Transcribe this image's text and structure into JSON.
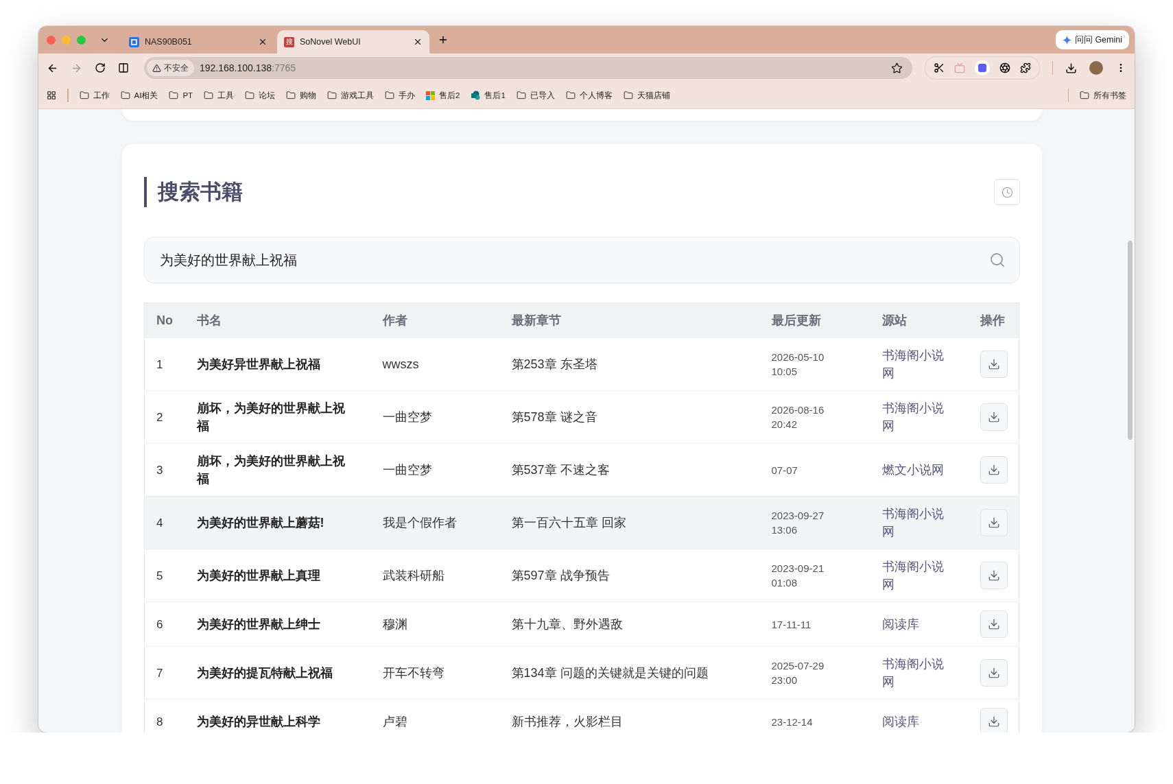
{
  "browser": {
    "tabs": [
      {
        "title": "NAS90B051",
        "selected": false
      },
      {
        "title": "SoNovel WebUI",
        "icon_text": "搜",
        "selected": true
      }
    ],
    "gemini_button": "问问 Gemini",
    "address": {
      "security": "不安全",
      "host": "192.168.100.138",
      "port": ":7765"
    },
    "bookmarks": [
      {
        "label": "工作",
        "kind": "folder"
      },
      {
        "label": "AI相关",
        "kind": "folder"
      },
      {
        "label": "PT",
        "kind": "folder"
      },
      {
        "label": "工具",
        "kind": "folder"
      },
      {
        "label": "论坛",
        "kind": "folder"
      },
      {
        "label": "购物",
        "kind": "folder"
      },
      {
        "label": "游戏工具",
        "kind": "folder"
      },
      {
        "label": "手办",
        "kind": "folder"
      },
      {
        "label": "售后2",
        "kind": "tiles"
      },
      {
        "label": "售后1",
        "kind": "share"
      },
      {
        "label": "已导入",
        "kind": "folder"
      },
      {
        "label": "个人博客",
        "kind": "folder"
      },
      {
        "label": "天猫店铺",
        "kind": "folder"
      }
    ],
    "all_bookmarks": "所有书签"
  },
  "page": {
    "title": "搜索书籍",
    "search": {
      "value": "为美好的世界献上祝福"
    },
    "table": {
      "columns": [
        "No",
        "书名",
        "作者",
        "最新章节",
        "最后更新",
        "源站",
        "操作"
      ],
      "rows": [
        {
          "no": "1",
          "name": "为美好异世界献上祝福",
          "author": "wwszs",
          "chapter": "第253章 东圣塔",
          "updated": "2026-05-10 10:05",
          "source": "书海阁小说网",
          "hovered": false
        },
        {
          "no": "2",
          "name": "崩坏，为美好的世界献上祝福",
          "author": "一曲空梦",
          "chapter": "第578章 谜之音",
          "updated": "2026-08-16 20:42",
          "source": "书海阁小说网",
          "hovered": false
        },
        {
          "no": "3",
          "name": "崩坏，为美好的世界献上祝福",
          "author": "一曲空梦",
          "chapter": "第537章 不速之客",
          "updated": "07-07",
          "source": "燃文小说网",
          "hovered": false
        },
        {
          "no": "4",
          "name": "为美好的世界献上蘑菇!",
          "author": "我是个假作者",
          "chapter": "第一百六十五章 回家",
          "updated": "2023-09-27 13:06",
          "source": "书海阁小说网",
          "hovered": true
        },
        {
          "no": "5",
          "name": "为美好的世界献上真理",
          "author": "武装科研船",
          "chapter": "第597章 战争预告",
          "updated": "2023-09-21 01:08",
          "source": "书海阁小说网",
          "hovered": false
        },
        {
          "no": "6",
          "name": "为美好的世界献上绅士",
          "author": "穆渊",
          "chapter": "第十九章、野外遇敌",
          "updated": "17-11-11",
          "source": "阅读库",
          "hovered": false
        },
        {
          "no": "7",
          "name": "为美好的提瓦特献上祝福",
          "author": "开车不转弯",
          "chapter": "第134章 问题的关键就是关键的问题",
          "updated": "2025-07-29 23:00",
          "source": "书海阁小说网",
          "hovered": false
        },
        {
          "no": "8",
          "name": "为美好的异世献上科学",
          "author": "卢碧",
          "chapter": "新书推荐，火影栏目",
          "updated": "23-12-14",
          "source": "阅读库",
          "hovered": false
        }
      ]
    }
  }
}
